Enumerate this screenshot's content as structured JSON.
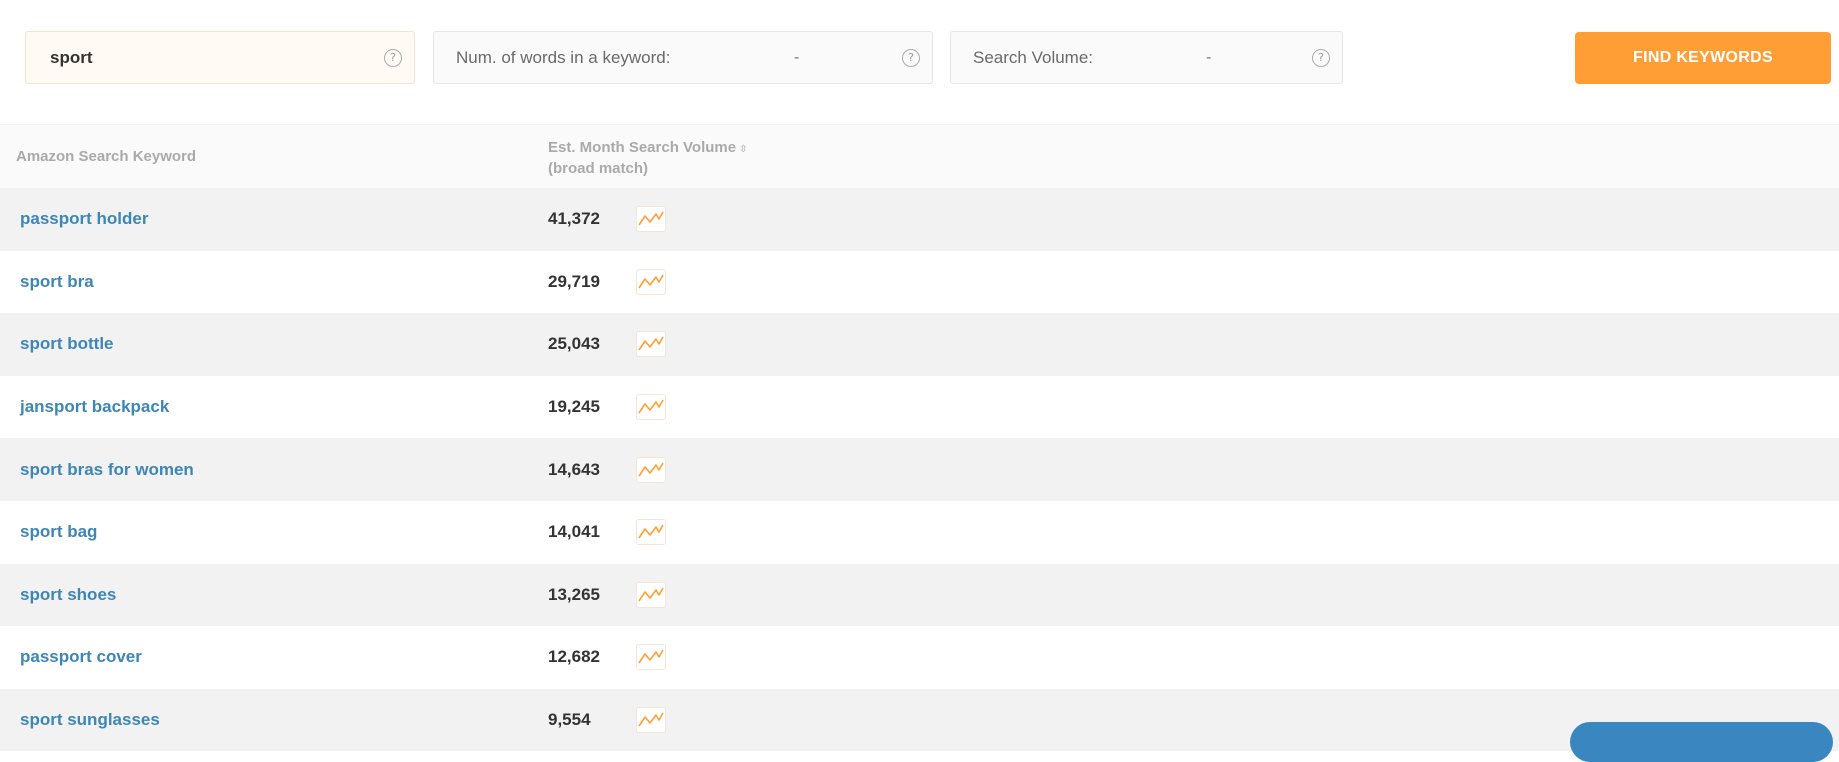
{
  "search": {
    "keyword_value": "sport",
    "words_label": "Num. of words in a keyword:",
    "words_value": "-",
    "volume_label": "Search Volume:",
    "volume_value": "-",
    "help_glyph": "?",
    "find_button": "FIND KEYWORDS"
  },
  "table": {
    "col_keyword": "Amazon Search Keyword",
    "col_volume_line1": "Est. Month Search Volume",
    "col_volume_line2": "(broad match)",
    "rows": [
      {
        "keyword": "passport holder",
        "volume": "41,372"
      },
      {
        "keyword": "sport bra",
        "volume": "29,719"
      },
      {
        "keyword": "sport bottle",
        "volume": "25,043"
      },
      {
        "keyword": "jansport backpack",
        "volume": "19,245"
      },
      {
        "keyword": "sport bras for women",
        "volume": "14,643"
      },
      {
        "keyword": "sport bag",
        "volume": "14,041"
      },
      {
        "keyword": "sport shoes",
        "volume": "13,265"
      },
      {
        "keyword": "passport cover",
        "volume": "12,682"
      },
      {
        "keyword": "sport sunglasses",
        "volume": "9,554"
      }
    ]
  },
  "icons": {
    "help": "question-circle-icon",
    "sort": "sort-icon",
    "trend": "trend-chart-icon"
  },
  "colors": {
    "accent": "#ff9e35",
    "link": "#3d86b6",
    "row_alt": "#f2f2f2",
    "chat": "#3a86c0"
  }
}
